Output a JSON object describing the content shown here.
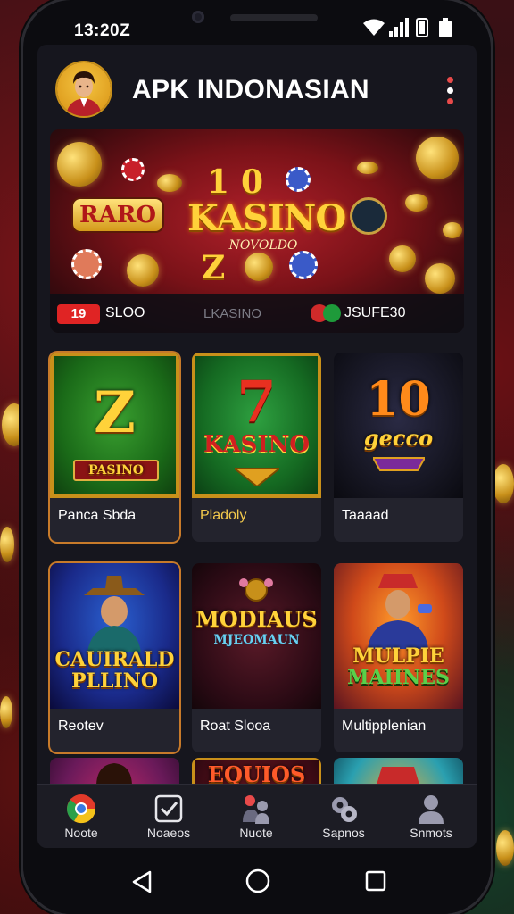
{
  "status_bar": {
    "time": "13:20Z"
  },
  "app_bar": {
    "title": "APK INDONASIAN"
  },
  "banner": {
    "left_label": "RARO",
    "title": "KASINO",
    "subtitle": "NOVOLDO",
    "num_top": "1",
    "num_top2": "0",
    "num_bottom": "Z",
    "badge": "19",
    "text1": "SLOO",
    "text2": "LKASINO",
    "text3": "JSUFE30"
  },
  "games": [
    {
      "art_title": "Z",
      "art_sub": "PASINO",
      "label": "Panca Sbda",
      "label_gold": false,
      "selected": true
    },
    {
      "art_title": "7",
      "art_sub": "KASINO",
      "label": "Pladoly",
      "label_gold": true,
      "selected": false
    },
    {
      "art_title": "10",
      "art_sub": "gecco",
      "label": "Taaaad",
      "label_gold": false,
      "selected": false
    },
    {
      "art_title": "CAUIRALD",
      "art_sub": "PLLINO",
      "label": "Reotev",
      "label_gold": false,
      "selected": true
    },
    {
      "art_title": "MODIAUS",
      "art_sub": "MJEOMAUN",
      "label": "Roat Slooa",
      "label_gold": false,
      "selected": false
    },
    {
      "art_title": "MULPIE",
      "art_sub": "MAIINES",
      "label": "Multipplenian",
      "label_gold": false,
      "selected": false
    },
    {
      "art_title": "",
      "art_sub": "",
      "label": "",
      "label_gold": false,
      "selected": false
    },
    {
      "art_title": "EQUIOS",
      "art_sub": "",
      "label": "",
      "label_gold": false,
      "selected": false
    },
    {
      "art_title": "",
      "art_sub": "",
      "label": "",
      "label_gold": false,
      "selected": false
    }
  ],
  "bottom_nav": [
    {
      "label": "Noote",
      "icon": "chrome-icon"
    },
    {
      "label": "Noaeos",
      "icon": "checkbox-icon"
    },
    {
      "label": "Nuote",
      "icon": "people-icon"
    },
    {
      "label": "Sapnos",
      "icon": "settings-icon"
    },
    {
      "label": "Snmots",
      "icon": "person-icon"
    }
  ],
  "colors": {
    "accent_red": "#e02424",
    "gold": "#ffd23a",
    "screen_bg": "#16161e",
    "card_bg": "#23232d",
    "selected_border": "#c77a2a"
  }
}
